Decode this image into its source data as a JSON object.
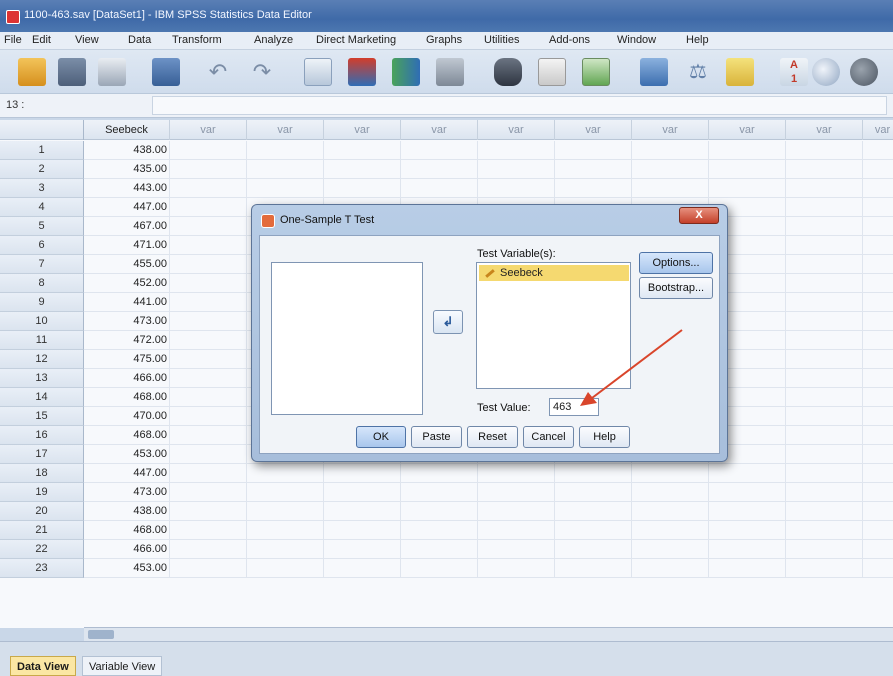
{
  "window": {
    "title": "1100-463.sav [DataSet1] - IBM SPSS Statistics Data Editor"
  },
  "menu": [
    "File",
    "Edit",
    "View",
    "Data",
    "Transform",
    "Analyze",
    "Direct Marketing",
    "Graphs",
    "Utilities",
    "Add-ons",
    "Window",
    "Help"
  ],
  "toolbar": {
    "icons": [
      "open-icon",
      "save-icon",
      "print-icon",
      "recall-dialog-icon",
      "undo-icon",
      "redo-icon",
      "goto-case-icon",
      "goto-variable-icon",
      "variables-icon",
      "run-descriptives-icon",
      "find-icon",
      "insert-cases-icon",
      "insert-variable-icon",
      "split-file-icon",
      "weight-cases-icon",
      "select-cases-icon",
      "value-labels-icon",
      "use-sets-icon",
      "show-all-icon"
    ]
  },
  "cell_editor": {
    "cell_reference": "13 :",
    "value": ""
  },
  "grid": {
    "columns": [
      "Seebeck",
      "var",
      "var",
      "var",
      "var",
      "var",
      "var",
      "var",
      "var",
      "var",
      "var"
    ],
    "rows": [
      {
        "n": "1",
        "seebeck": "438.00"
      },
      {
        "n": "2",
        "seebeck": "435.00"
      },
      {
        "n": "3",
        "seebeck": "443.00"
      },
      {
        "n": "4",
        "seebeck": "447.00"
      },
      {
        "n": "5",
        "seebeck": "467.00"
      },
      {
        "n": "6",
        "seebeck": "471.00"
      },
      {
        "n": "7",
        "seebeck": "455.00"
      },
      {
        "n": "8",
        "seebeck": "452.00"
      },
      {
        "n": "9",
        "seebeck": "441.00"
      },
      {
        "n": "10",
        "seebeck": "473.00"
      },
      {
        "n": "11",
        "seebeck": "472.00"
      },
      {
        "n": "12",
        "seebeck": "475.00"
      },
      {
        "n": "13",
        "seebeck": "466.00"
      },
      {
        "n": "14",
        "seebeck": "468.00"
      },
      {
        "n": "15",
        "seebeck": "470.00"
      },
      {
        "n": "16",
        "seebeck": "468.00"
      },
      {
        "n": "17",
        "seebeck": "453.00"
      },
      {
        "n": "18",
        "seebeck": "447.00"
      },
      {
        "n": "19",
        "seebeck": "473.00"
      },
      {
        "n": "20",
        "seebeck": "438.00"
      },
      {
        "n": "21",
        "seebeck": "468.00"
      },
      {
        "n": "22",
        "seebeck": "466.00"
      },
      {
        "n": "23",
        "seebeck": "453.00"
      }
    ]
  },
  "tabs": {
    "data_view": "Data View",
    "variable_view": "Variable View"
  },
  "dialog": {
    "title": "One-Sample T Test",
    "close_label": "X",
    "test_variables_label": "Test Variable(s):",
    "test_variables": [
      "Seebeck"
    ],
    "options_label": "Options...",
    "bootstrap_label": "Bootstrap...",
    "test_value_label": "Test Value:",
    "test_value": "463",
    "buttons": {
      "ok": "OK",
      "paste": "Paste",
      "reset": "Reset",
      "cancel": "Cancel",
      "help": "Help"
    }
  },
  "colors": {
    "selected_variable": "#f5d970",
    "annotation_arrow": "#d9452b",
    "active_tab": "#fbe7a4"
  }
}
